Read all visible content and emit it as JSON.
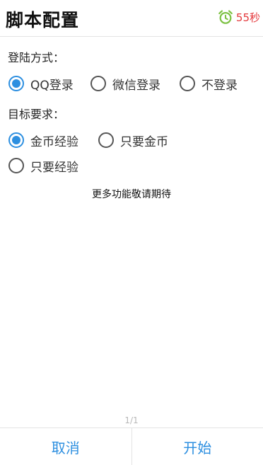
{
  "header": {
    "title": "脚本配置",
    "timer_icon": "alarm-clock-icon",
    "timer_text": "55秒"
  },
  "login": {
    "label": "登陆方式：",
    "options": [
      {
        "label": "QQ登录",
        "checked": true
      },
      {
        "label": "微信登录",
        "checked": false
      },
      {
        "label": "不登录",
        "checked": false
      }
    ]
  },
  "target": {
    "label": "目标要求：",
    "options": [
      {
        "label": "金币经验",
        "checked": true
      },
      {
        "label": "只要金币",
        "checked": false
      },
      {
        "label": "只要经验",
        "checked": false
      }
    ]
  },
  "info_text": "更多功能敬请期待",
  "pager": "1/1",
  "buttons": {
    "cancel": "取消",
    "start": "开始"
  },
  "colors": {
    "accent": "#2d8fe0",
    "timer": "#e4393c",
    "clock": "#7cc142"
  }
}
